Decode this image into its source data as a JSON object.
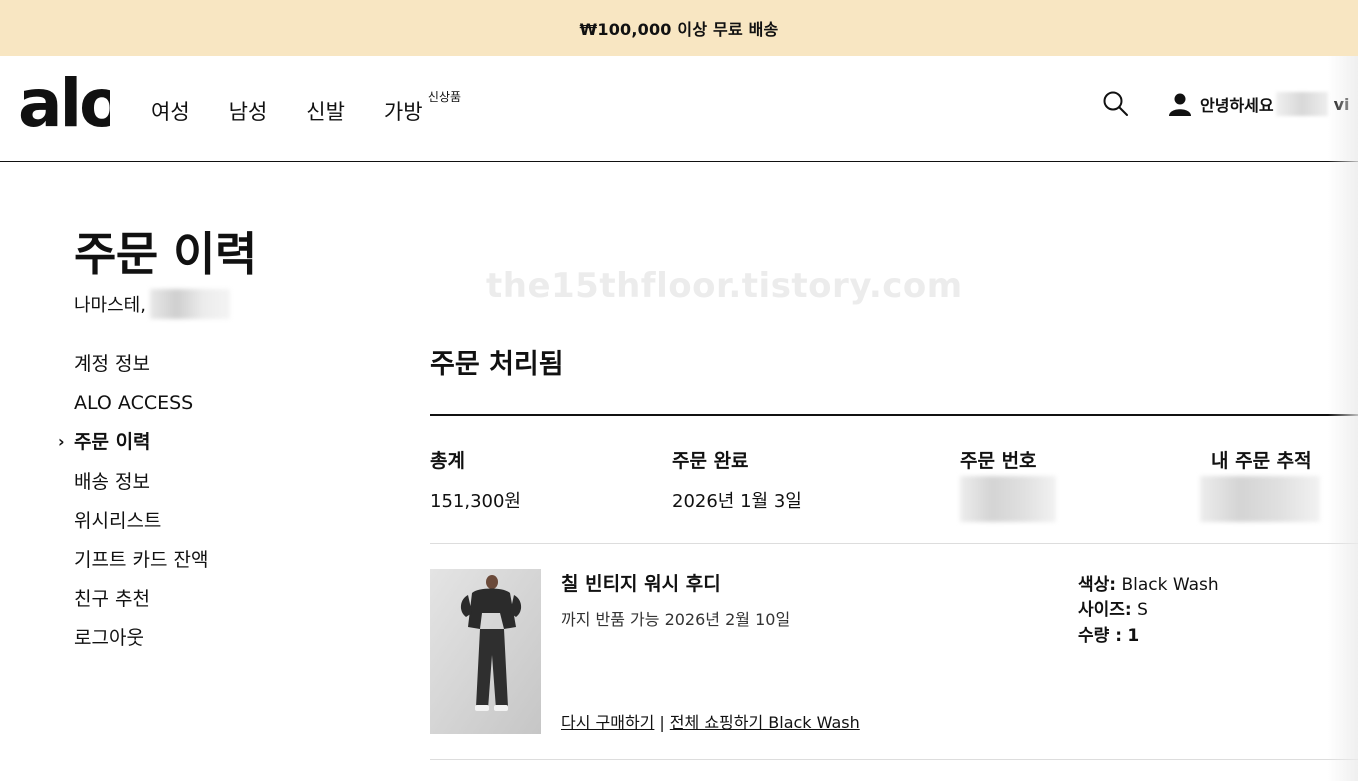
{
  "promo": {
    "text": "₩100,000 이상 무료 배송"
  },
  "header": {
    "logo_text": "alo",
    "nav": [
      {
        "label": "여성"
      },
      {
        "label": "남성"
      },
      {
        "label": "신발"
      },
      {
        "label": "가방",
        "sup": "신상품"
      }
    ],
    "account": {
      "greeting": "안녕하세요",
      "tail": "vi"
    }
  },
  "page": {
    "title": "주문 이력",
    "greeting": "나마스테,",
    "watermark": "the15thfloor.tistory.com"
  },
  "sidebar": {
    "items": [
      {
        "label": "계정 정보",
        "active": false
      },
      {
        "label": "ALO ACCESS",
        "active": false
      },
      {
        "label": "주문 이력",
        "active": true,
        "caret": "›"
      },
      {
        "label": "배송 정보",
        "active": false
      },
      {
        "label": "위시리스트",
        "active": false
      },
      {
        "label": "기프트 카드 잔액",
        "active": false
      },
      {
        "label": "친구 추천",
        "active": false
      },
      {
        "label": "로그아웃",
        "active": false
      }
    ]
  },
  "order": {
    "status": "주문 처리됨",
    "summary": {
      "total_label": "총계",
      "total_value": "151,300원",
      "completed_label": "주문 완료",
      "completed_value": "2026년 1월 3일",
      "number_label": "주문 번호",
      "tracking_label": "내 주문 추적"
    },
    "item": {
      "name": "칠 빈티지 워시 후디",
      "return_note": "까지 반품 가능 2026년 2월 10일",
      "rebuy_link": "다시 구매하기",
      "separator": "|",
      "shop_all_link": "전체 쇼핑하기 Black Wash",
      "color_label": "색상:",
      "color_value": "Black Wash",
      "size_label": "사이즈:",
      "size_value": "S",
      "qty_label": "수량 :",
      "qty_value": "1"
    }
  },
  "colors": {
    "promo_bg": "#f8e6c2",
    "text": "#111111",
    "divider": "#dddddd"
  }
}
